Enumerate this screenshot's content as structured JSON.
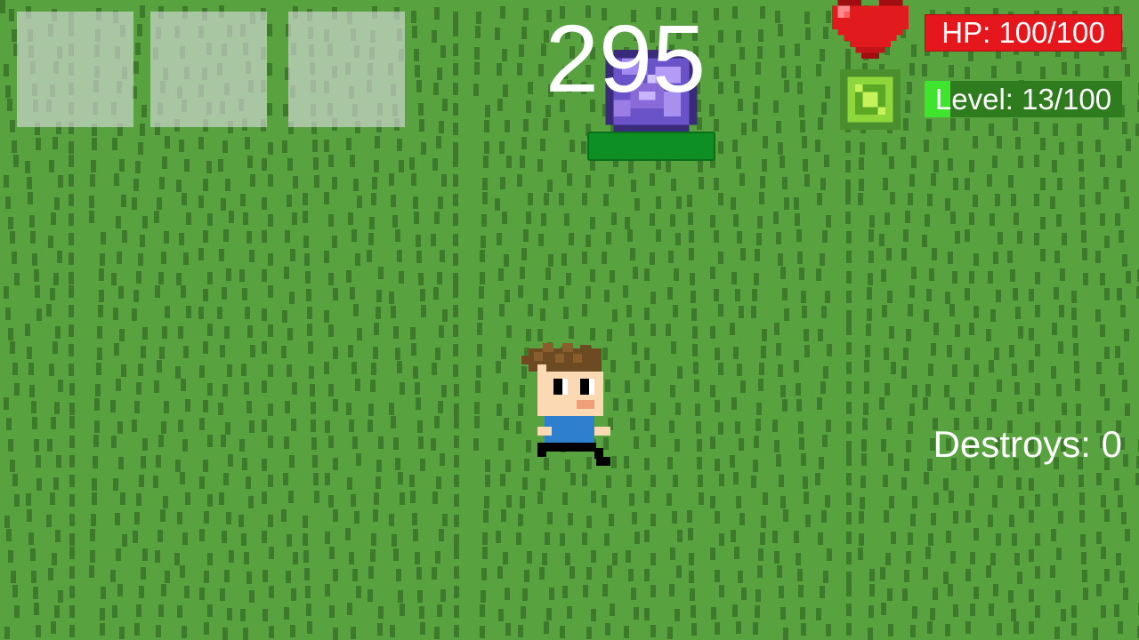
{
  "hud": {
    "score": "295",
    "hp_text": "HP: 100/100",
    "hp_current": 100,
    "hp_max": 100,
    "level_text": "Level: 13/100",
    "level_current": 13,
    "level_max": 100,
    "destroys_text": "Destroys: 0"
  },
  "inventory": {
    "slots": [
      {
        "item": ""
      },
      {
        "item": ""
      },
      {
        "item": ""
      }
    ]
  },
  "enemy": {
    "kind": "purple-portal",
    "health_fraction": 1.0
  },
  "icons": {
    "heart": "heart-icon",
    "xp": "xp-gem-icon"
  },
  "colors": {
    "grass": "#58a240",
    "grass_blade": "#3d7a2c",
    "hp_bar": "#e5161c",
    "level_bar_bg": "#2e7c1e",
    "level_bar_fill": "#3ee52c",
    "enemy_health": "#0d8f24",
    "portal": "#8a6ad8"
  }
}
